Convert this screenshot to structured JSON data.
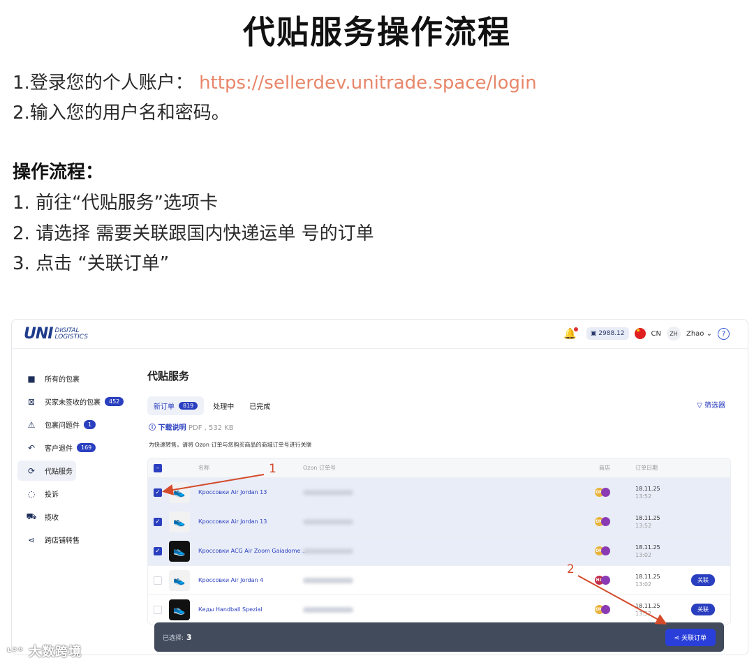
{
  "doc": {
    "title": "代贴服务操作流程",
    "line1_prefix": "1.登录您的个人账户：",
    "line1_link": "https://sellerdev.unitrade.space/login",
    "line2": "2.输入您的用户名和密码。",
    "section": "操作流程：",
    "steps": [
      "1. 前往“代贴服务”选项卡",
      "2. 请选择 需要关联跟国内快递运单 号的订单",
      "3. 点击 “关联订单”"
    ]
  },
  "app": {
    "logo_main": "UNI",
    "logo_sub1": "DIGITAL",
    "logo_sub2": "LOGISTICS",
    "balance": "2988.12",
    "lang": "CN",
    "avatar": "ZH",
    "user": "Zhao",
    "sidebar": [
      {
        "label": "所有的包裹",
        "badge": ""
      },
      {
        "label": "买家未签收的包裹",
        "badge": "452"
      },
      {
        "label": "包裹问题件",
        "badge": "1"
      },
      {
        "label": "客户退件",
        "badge": "169"
      },
      {
        "label": "代贴服务",
        "badge": ""
      },
      {
        "label": "投诉",
        "badge": ""
      },
      {
        "label": "揽收",
        "badge": ""
      },
      {
        "label": "跨店铺转售",
        "badge": ""
      }
    ],
    "page_title": "代贴服务",
    "tabs": [
      {
        "label": "新订单",
        "count": "819"
      },
      {
        "label": "处理中",
        "count": ""
      },
      {
        "label": "已完成",
        "count": ""
      }
    ],
    "filter": "筛选器",
    "download_label": "下载说明",
    "download_meta": "PDF , 532 KB",
    "hint": "为快速转售，请将 Ozon 订单与您购买商品的商城订单号进行关联",
    "columns": {
      "name": "名称",
      "ozon": "Ozon 订单号",
      "store": "商店",
      "date": "订单日期"
    },
    "rows": [
      {
        "name": "Кроссовки Air Jordan 13",
        "date": "18.11.25",
        "time": "13:52",
        "store": "OM",
        "selected": true,
        "action": ""
      },
      {
        "name": "Кроссовки Air Jordan 13",
        "date": "18.11.25",
        "time": "13:52",
        "store": "OM",
        "selected": true,
        "action": ""
      },
      {
        "name": "Кроссовки ACG Air Zoom Gaiadome ...",
        "date": "18.11.25",
        "time": "13:02",
        "store": "OM",
        "selected": true,
        "action": ""
      },
      {
        "name": "Кроссовки Air Jordan 4",
        "date": "18.11.25",
        "time": "13:02",
        "store": "HX",
        "selected": false,
        "action": "关联"
      },
      {
        "name": "Кеды Handball Spezial",
        "date": "18.11.25",
        "time": "13:52",
        "store": "OM",
        "selected": false,
        "action": "关联"
      }
    ],
    "selected_label": "已选择:",
    "selected_count": "3",
    "link_orders_button": "关联订单"
  },
  "annotations": {
    "a1": "1",
    "a2": "2"
  },
  "watermark": "大数跨境"
}
